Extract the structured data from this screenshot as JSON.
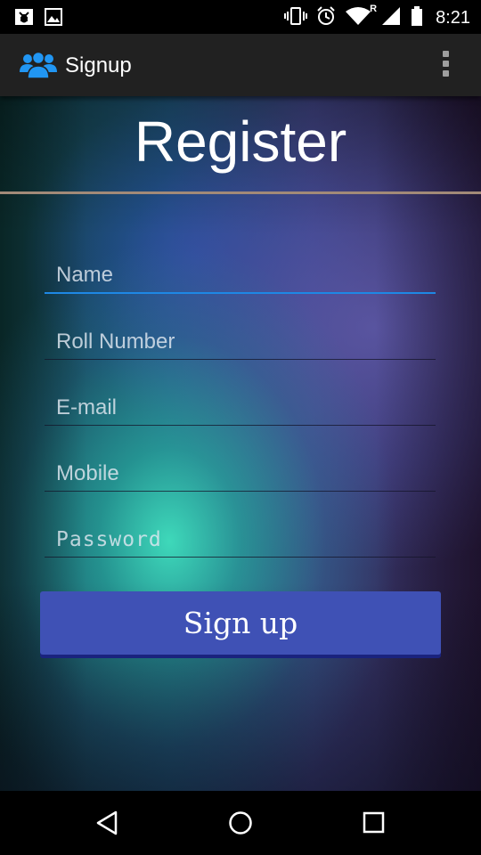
{
  "status_bar": {
    "time": "8:21",
    "left_icons": [
      "bug-notification-icon",
      "image-notification-icon"
    ],
    "right_icons": [
      "vibrate-icon",
      "alarm-icon",
      "wifi-icon",
      "signal-icon",
      "battery-icon"
    ],
    "roaming_indicator": "R"
  },
  "action_bar": {
    "title": "Signup",
    "app_icon": "users-group-icon",
    "accent_color": "#2196f3",
    "menu_icon": "overflow-menu-icon"
  },
  "page": {
    "title": "Register"
  },
  "form": {
    "name_placeholder": "Name",
    "roll_placeholder": "Roll Number",
    "email_placeholder": "E-mail",
    "mobile_placeholder": "Mobile",
    "password_placeholder": "Password",
    "focus_color": "#1e88e5",
    "submit_label": "Sign up",
    "submit_color": "#3f51b5"
  },
  "nav_bar": {
    "icons": [
      "back-icon",
      "home-icon",
      "recents-icon"
    ]
  }
}
